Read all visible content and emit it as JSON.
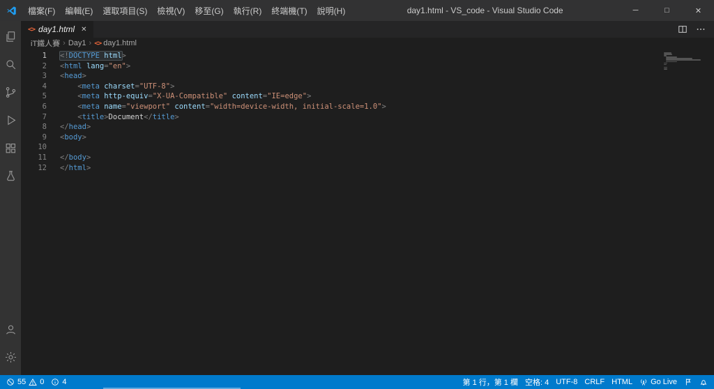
{
  "title_bar": {
    "title": "day1.html - VS_code - Visual Studio Code",
    "menus": [
      {
        "id": "file",
        "label": "檔案(F)"
      },
      {
        "id": "edit",
        "label": "編輯(E)"
      },
      {
        "id": "selection",
        "label": "選取項目(S)"
      },
      {
        "id": "view",
        "label": "檢視(V)"
      },
      {
        "id": "go",
        "label": "移至(G)"
      },
      {
        "id": "run",
        "label": "執行(R)"
      },
      {
        "id": "terminal",
        "label": "終端機(T)"
      },
      {
        "id": "help",
        "label": "說明(H)"
      }
    ],
    "controls": {
      "minimize": "─",
      "maximize": "□",
      "close": "✕"
    }
  },
  "icons": {
    "html_file_glyph": "<>",
    "close_glyph": "✕",
    "breadcrumb_separator": "›"
  },
  "colors": {
    "accent": "#007acc",
    "html_icon_orange": "#e8653a",
    "logo_blue": "#1f9cf0"
  },
  "tab": {
    "label": "day1.html"
  },
  "breadcrumb": {
    "items": [
      {
        "id": "it-ironman",
        "label": "iT鐵人賽",
        "icon": false
      },
      {
        "id": "day1",
        "label": "Day1",
        "icon": false
      },
      {
        "id": "day1-html",
        "label": "day1.html",
        "icon": true
      }
    ]
  },
  "editor": {
    "active_line": 1,
    "syntax_colors": {
      "punct": "#808080",
      "tag": "#569cd6",
      "attr": "#9cdcfe",
      "str": "#ce9178",
      "txt": "#d4d4d4"
    },
    "lines": [
      {
        "n": "1",
        "tokens": [
          {
            "c": "punct",
            "t": "<!",
            "hl": true
          },
          {
            "c": "tag",
            "t": "DOCTYPE",
            "hl": true
          },
          {
            "c": "attr",
            "t": " html",
            "hl": true
          },
          {
            "c": "punct",
            "t": ">"
          }
        ]
      },
      {
        "n": "2",
        "tokens": [
          {
            "c": "punct",
            "t": "<"
          },
          {
            "c": "tag",
            "t": "html"
          },
          {
            "c": "attr",
            "t": " lang"
          },
          {
            "c": "punct",
            "t": "="
          },
          {
            "c": "str",
            "t": "\"en\""
          },
          {
            "c": "punct",
            "t": ">"
          }
        ]
      },
      {
        "n": "3",
        "tokens": [
          {
            "c": "punct",
            "t": "<"
          },
          {
            "c": "tag",
            "t": "head"
          },
          {
            "c": "punct",
            "t": ">"
          }
        ]
      },
      {
        "n": "4",
        "tokens": [
          {
            "c": "punct",
            "t": "    <"
          },
          {
            "c": "tag",
            "t": "meta"
          },
          {
            "c": "attr",
            "t": " charset"
          },
          {
            "c": "punct",
            "t": "="
          },
          {
            "c": "str",
            "t": "\"UTF-8\""
          },
          {
            "c": "punct",
            "t": ">"
          }
        ]
      },
      {
        "n": "5",
        "tokens": [
          {
            "c": "punct",
            "t": "    <"
          },
          {
            "c": "tag",
            "t": "meta"
          },
          {
            "c": "attr",
            "t": " http-equiv"
          },
          {
            "c": "punct",
            "t": "="
          },
          {
            "c": "str",
            "t": "\"X-UA-Compatible\""
          },
          {
            "c": "attr",
            "t": " content"
          },
          {
            "c": "punct",
            "t": "="
          },
          {
            "c": "str",
            "t": "\"IE=edge\""
          },
          {
            "c": "punct",
            "t": ">"
          }
        ]
      },
      {
        "n": "6",
        "tokens": [
          {
            "c": "punct",
            "t": "    <"
          },
          {
            "c": "tag",
            "t": "meta"
          },
          {
            "c": "attr",
            "t": " name"
          },
          {
            "c": "punct",
            "t": "="
          },
          {
            "c": "str",
            "t": "\"viewport\""
          },
          {
            "c": "attr",
            "t": " content"
          },
          {
            "c": "punct",
            "t": "="
          },
          {
            "c": "str",
            "t": "\"width=device-width, initial-scale=1.0\""
          },
          {
            "c": "punct",
            "t": ">"
          }
        ]
      },
      {
        "n": "7",
        "tokens": [
          {
            "c": "punct",
            "t": "    <"
          },
          {
            "c": "tag",
            "t": "title"
          },
          {
            "c": "punct",
            "t": ">"
          },
          {
            "c": "txt",
            "t": "Document"
          },
          {
            "c": "punct",
            "t": "</"
          },
          {
            "c": "tag",
            "t": "title"
          },
          {
            "c": "punct",
            "t": ">"
          }
        ]
      },
      {
        "n": "8",
        "tokens": [
          {
            "c": "punct",
            "t": "</"
          },
          {
            "c": "tag",
            "t": "head"
          },
          {
            "c": "punct",
            "t": ">"
          }
        ]
      },
      {
        "n": "9",
        "tokens": [
          {
            "c": "punct",
            "t": "<"
          },
          {
            "c": "tag",
            "t": "body"
          },
          {
            "c": "punct",
            "t": ">"
          }
        ]
      },
      {
        "n": "10",
        "tokens": []
      },
      {
        "n": "11",
        "tokens": [
          {
            "c": "punct",
            "t": "</"
          },
          {
            "c": "tag",
            "t": "body"
          },
          {
            "c": "punct",
            "t": ">"
          }
        ]
      },
      {
        "n": "12",
        "tokens": [
          {
            "c": "punct",
            "t": "</"
          },
          {
            "c": "tag",
            "t": "html"
          },
          {
            "c": "punct",
            "t": ">"
          }
        ]
      }
    ]
  },
  "status_bar": {
    "problems": {
      "errors": "55",
      "warnings": "0"
    },
    "info_count": "4",
    "cursor_position": "第 1 行，第 1 欄",
    "indentation": "空格: 4",
    "encoding": "UTF-8",
    "eol": "CRLF",
    "language": "HTML",
    "go_live": "Go Live"
  }
}
